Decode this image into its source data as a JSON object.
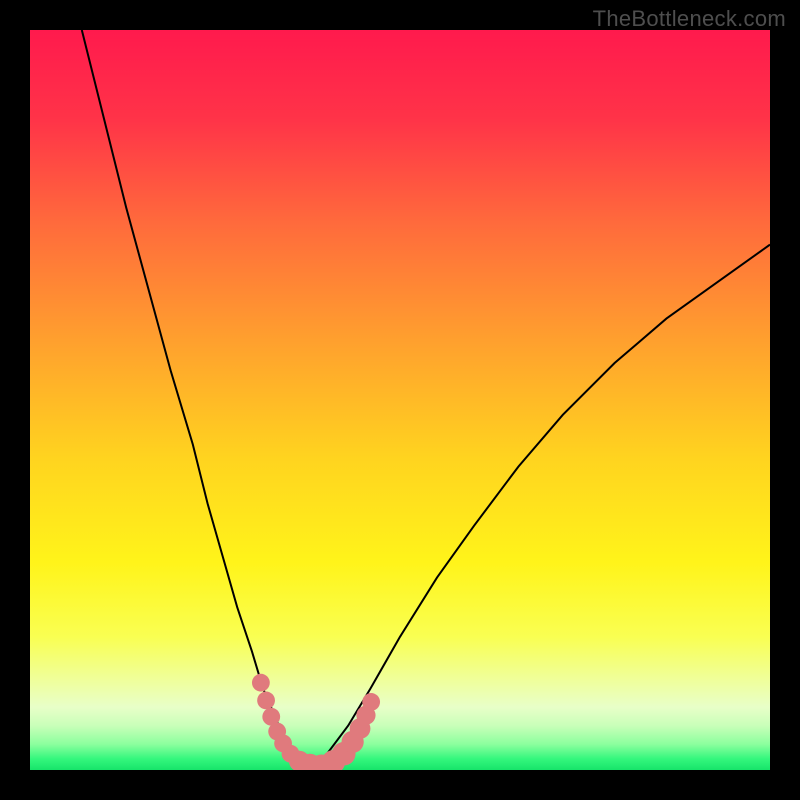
{
  "watermark": "TheBottleneck.com",
  "chart_data": {
    "type": "line",
    "title": "",
    "xlabel": "",
    "ylabel": "",
    "xlim": [
      0,
      100
    ],
    "ylim": [
      0,
      100
    ],
    "series": [
      {
        "name": "left-curve",
        "x": [
          7,
          10,
          13,
          16,
          19,
          22,
          24,
          26,
          28,
          30,
          31.5,
          33,
          34,
          35,
          36,
          37,
          38
        ],
        "values": [
          100,
          88,
          76,
          65,
          54,
          44,
          36,
          29,
          22,
          16,
          11,
          7.5,
          5,
          3.2,
          1.8,
          0.8,
          0.2
        ]
      },
      {
        "name": "right-curve",
        "x": [
          38,
          40,
          43,
          46,
          50,
          55,
          60,
          66,
          72,
          79,
          86,
          93,
          100
        ],
        "values": [
          0.2,
          2,
          6,
          11,
          18,
          26,
          33,
          41,
          48,
          55,
          61,
          66,
          71
        ]
      }
    ],
    "markers": {
      "name": "highlighted-points",
      "color": "#e07a7d",
      "points": [
        {
          "x": 31.2,
          "y": 11.8,
          "r": 1.2
        },
        {
          "x": 31.9,
          "y": 9.4,
          "r": 1.2
        },
        {
          "x": 32.6,
          "y": 7.2,
          "r": 1.2
        },
        {
          "x": 33.4,
          "y": 5.2,
          "r": 1.2
        },
        {
          "x": 34.2,
          "y": 3.6,
          "r": 1.2
        },
        {
          "x": 35.2,
          "y": 2.2,
          "r": 1.2
        },
        {
          "x": 36.4,
          "y": 1.2,
          "r": 1.4
        },
        {
          "x": 37.8,
          "y": 0.6,
          "r": 1.6
        },
        {
          "x": 39.4,
          "y": 0.5,
          "r": 1.6
        },
        {
          "x": 41.0,
          "y": 1.1,
          "r": 1.6
        },
        {
          "x": 42.4,
          "y": 2.2,
          "r": 1.6
        },
        {
          "x": 43.6,
          "y": 3.8,
          "r": 1.5
        },
        {
          "x": 44.6,
          "y": 5.6,
          "r": 1.4
        },
        {
          "x": 45.4,
          "y": 7.4,
          "r": 1.3
        },
        {
          "x": 46.1,
          "y": 9.2,
          "r": 1.2
        }
      ]
    },
    "gradient_stops": [
      {
        "pos": 0.0,
        "color": "#ff1a4d"
      },
      {
        "pos": 0.12,
        "color": "#ff3348"
      },
      {
        "pos": 0.26,
        "color": "#ff6a3c"
      },
      {
        "pos": 0.42,
        "color": "#ffa02e"
      },
      {
        "pos": 0.58,
        "color": "#ffd41f"
      },
      {
        "pos": 0.72,
        "color": "#fff41a"
      },
      {
        "pos": 0.82,
        "color": "#f9ff52"
      },
      {
        "pos": 0.88,
        "color": "#efff9d"
      },
      {
        "pos": 0.915,
        "color": "#e8ffc8"
      },
      {
        "pos": 0.94,
        "color": "#c9ffb9"
      },
      {
        "pos": 0.965,
        "color": "#8cff9e"
      },
      {
        "pos": 0.985,
        "color": "#34f77d"
      },
      {
        "pos": 1.0,
        "color": "#17e46a"
      }
    ]
  }
}
